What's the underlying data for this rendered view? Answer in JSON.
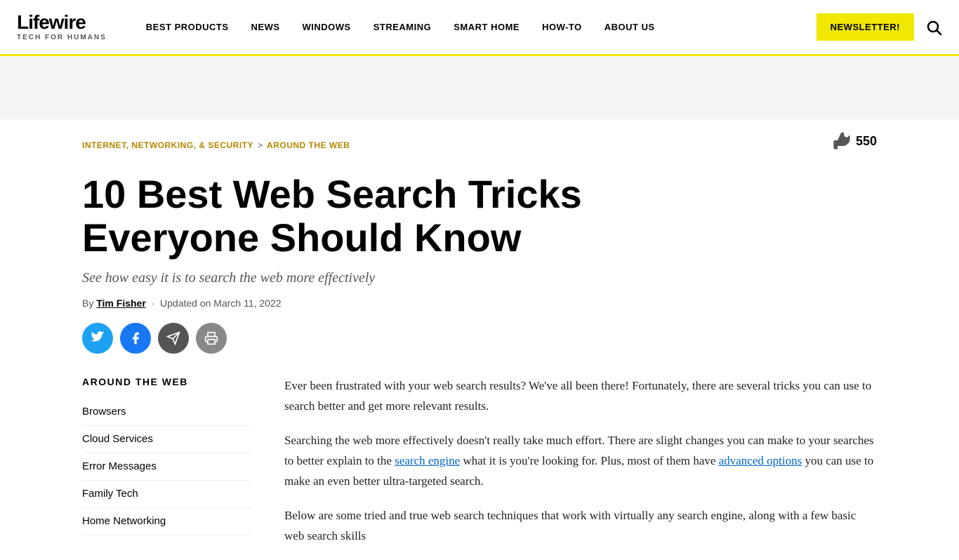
{
  "header": {
    "logo": "Lifewire",
    "tagline": "TECH FOR HUMANS",
    "nav": [
      {
        "label": "BEST PRODUCTS",
        "id": "best-products"
      },
      {
        "label": "NEWS",
        "id": "news"
      },
      {
        "label": "WINDOWS",
        "id": "windows"
      },
      {
        "label": "STREAMING",
        "id": "streaming"
      },
      {
        "label": "SMART HOME",
        "id": "smart-home"
      },
      {
        "label": "HOW-TO",
        "id": "how-to"
      },
      {
        "label": "ABOUT US",
        "id": "about-us"
      }
    ],
    "newsletter_label": "NEWSLETTER!",
    "search_label": "Search"
  },
  "breadcrumb": {
    "parent": "INTERNET, NETWORKING, & SECURITY",
    "separator": ">",
    "current": "AROUND THE WEB"
  },
  "like_count": "550",
  "article": {
    "title": "10 Best Web Search Tricks Everyone Should Know",
    "subtitle": "See how easy it is to search the web more effectively",
    "author_label": "By",
    "author_name": "Tim Fisher",
    "updated_label": "Updated on March 11, 2022",
    "body": [
      "Ever been frustrated with your web search results? We've all been there! Fortunately, there are several tricks you can use to search better and get more relevant results.",
      "Searching the web more effectively doesn't really take much effort. There are slight changes you can make to your searches to better explain to the search engine what it is you're looking for. Plus, most of them have advanced options you can use to make an even better ultra-targeted search.",
      "Below are some tried and true web search techniques that work with virtually any search engine, along with a few basic web search skills"
    ],
    "inline_links": [
      {
        "text": "search engine",
        "href": "#"
      },
      {
        "text": "advanced options",
        "href": "#"
      }
    ]
  },
  "social": {
    "buttons": [
      {
        "id": "twitter",
        "label": "Twitter",
        "icon": "🐦"
      },
      {
        "id": "facebook",
        "label": "Facebook",
        "icon": "f"
      },
      {
        "id": "email",
        "label": "Email",
        "icon": "✉"
      },
      {
        "id": "print",
        "label": "Print",
        "icon": "🖨"
      }
    ]
  },
  "sidebar": {
    "section_title": "AROUND THE WEB",
    "items": [
      {
        "label": "Browsers"
      },
      {
        "label": "Cloud Services"
      },
      {
        "label": "Error Messages"
      },
      {
        "label": "Family Tech"
      },
      {
        "label": "Home Networking"
      }
    ]
  }
}
